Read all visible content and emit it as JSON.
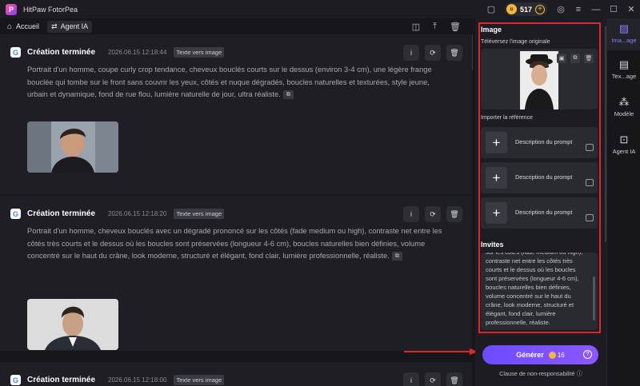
{
  "app": {
    "title": "HitPaw FotorPea",
    "credits": "517"
  },
  "nav": {
    "home": "Accueil",
    "agent": "Agent IA"
  },
  "cards": [
    {
      "title": "Création terminée",
      "time": "2026.06.15  12:18:44",
      "tag": "Texte vers image",
      "text": "Portrait d'un homme, coupe curly crop tendance, cheveux bouclés courts sur le dessus (environ 3-4 cm), une légère frange bouclée qui tombe sur le front sans couvrir les yeux, côtés et nuque dégradés, boucles naturelles et texturées, style jeune, urbain et dynamique, fond de rue flou, lumière naturelle de jour, ultra réaliste."
    },
    {
      "title": "Création terminée",
      "time": "2026.06.15  12:18:20",
      "tag": "Texte vers image",
      "text": "Portrait d'un homme, cheveux bouclés avec un dégradé prononcé sur les côtés (fade medium ou high), contraste net entre les côtés très courts et le dessus où les boucles sont préservées (longueur 4-6 cm), boucles naturelles bien définies, volume concentré sur le haut du crâne, look moderne, structuré et élégant, fond clair, lumière professionnelle, réaliste."
    },
    {
      "title": "Création terminée",
      "time": "2026.06.15  12:18:00",
      "tag": "Texte vers image"
    }
  ],
  "panel": {
    "image_title": "Image",
    "upload_label": "Téléversez l'image originale",
    "reference_label": "Importer la référence",
    "reference_items": [
      "Description du prompt",
      "Description du prompt",
      "Description du prompt"
    ],
    "prompts_title": "Invites",
    "prompt_text": "sur les côtés (fade medium ou high), contraste net entre les côtés très courts et le dessus où les boucles sont préservées (longueur 4-6 cm), boucles naturelles bien définies, volume concentré sur le haut du crâne, look moderne, structuré et élégant, fond clair, lumière professionnelle, réaliste.",
    "generate_label": "Générer",
    "generate_cost": "16",
    "disclaimer": "Clause de non-responsabilité"
  },
  "rail": [
    {
      "label": "Ima...age",
      "icon": "image-icon"
    },
    {
      "label": "Tex...age",
      "icon": "text-image-icon"
    },
    {
      "label": "Modèle",
      "icon": "model-icon"
    },
    {
      "label": "Agent IA",
      "icon": "agent-icon"
    }
  ],
  "colors": {
    "accent": "#7b5cff",
    "highlight": "#e0262b",
    "coin": "#f4b73b"
  }
}
